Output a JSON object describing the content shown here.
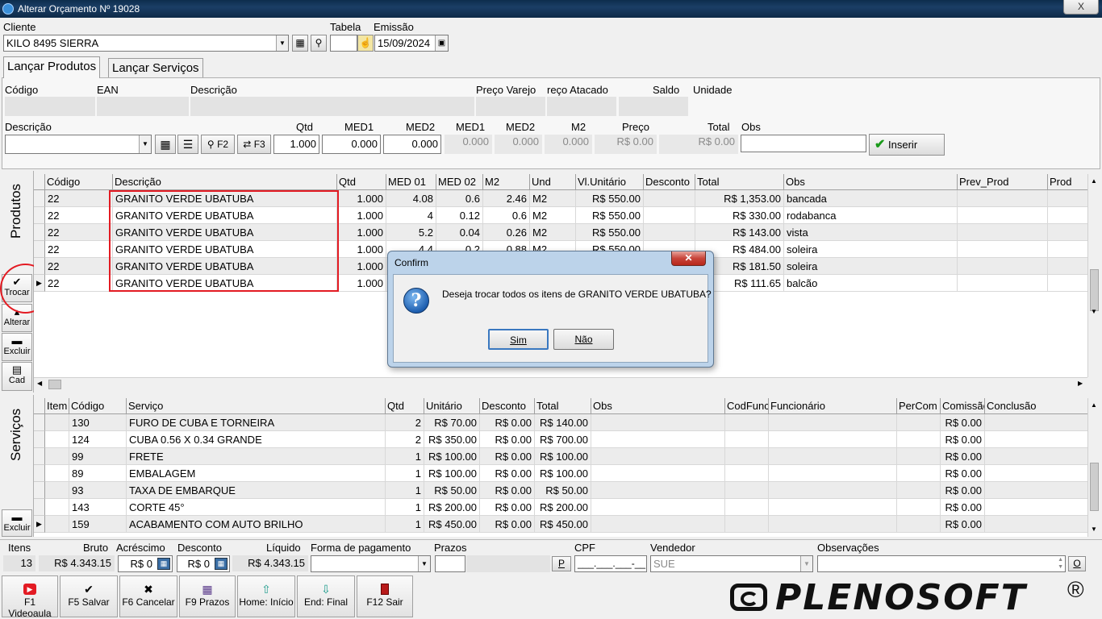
{
  "window": {
    "title": "Alterar Orçamento Nº 19028",
    "close_label": "X"
  },
  "header": {
    "cliente_label": "Cliente",
    "cliente_value": "KILO 8495 SIERRA",
    "tabela_label": "Tabela",
    "emissao_label": "Emissão",
    "emissao_value": "15/09/2024"
  },
  "tabs": [
    {
      "label": "Lançar Produtos",
      "active": true
    },
    {
      "label": "Lançar Serviços",
      "active": false
    }
  ],
  "produto_info": {
    "labels": {
      "codigo": "Código",
      "ean": "EAN",
      "descricao": "Descrição",
      "preco_varejo": "Preço Varejo",
      "preco_atacado": "reço Atacado",
      "saldo": "Saldo",
      "unidade": "Unidade"
    }
  },
  "insert_row": {
    "labels": {
      "descricao": "Descrição",
      "qtd": "Qtd",
      "med1": "MED1",
      "med2": "MED2",
      "med1_ro": "MED1",
      "med2_ro": "MED2",
      "m2": "M2",
      "preco": "Preço",
      "total": "Total",
      "obs": "Obs"
    },
    "values": {
      "qtd": "1.000",
      "med1": "0.000",
      "med2": "0.000",
      "med1_ro": "0.000",
      "med2_ro": "0.000",
      "m2": "0.000",
      "preco": "R$ 0.00",
      "total": "R$ 0.00"
    },
    "f2_label": "F2",
    "f3_label": "F3",
    "inserir_label": "Inserir"
  },
  "side_buttons": {
    "produtos_label": "Produtos",
    "servicos_label": "Serviços",
    "trocar": "Trocar",
    "alterar": "Alterar",
    "excluir": "Excluir",
    "cad": "Cad",
    "excluir2": "Excluir"
  },
  "products_grid": {
    "headers": [
      "Código",
      "Descrição",
      "Qtd",
      "MED 01",
      "MED 02",
      "M2",
      "Und",
      "Vl.Unitário",
      "Desconto",
      "Total",
      "Obs",
      "Prev_Prod",
      "Prod"
    ],
    "rows": [
      [
        "22",
        "GRANITO VERDE UBATUBA",
        "1.000",
        "4.08",
        "0.6",
        "2.46",
        "M2",
        "R$ 550.00",
        "",
        "R$ 1,353.00",
        "bancada",
        "",
        ""
      ],
      [
        "22",
        "GRANITO VERDE UBATUBA",
        "1.000",
        "4",
        "0.12",
        "0.6",
        "M2",
        "R$ 550.00",
        "",
        "R$ 330.00",
        "rodabanca",
        "",
        ""
      ],
      [
        "22",
        "GRANITO VERDE UBATUBA",
        "1.000",
        "5.2",
        "0.04",
        "0.26",
        "M2",
        "R$ 550.00",
        "",
        "R$ 143.00",
        "vista",
        "",
        ""
      ],
      [
        "22",
        "GRANITO VERDE UBATUBA",
        "1.000",
        "4.4",
        "0.2",
        "0.88",
        "M2",
        "R$ 550.00",
        "",
        "R$ 484.00",
        "soleira",
        "",
        ""
      ],
      [
        "22",
        "GRANITO VERDE UBATUBA",
        "1.000",
        "",
        "",
        "",
        "",
        "",
        "",
        "R$ 181.50",
        "soleira",
        "",
        ""
      ],
      [
        "22",
        "GRANITO VERDE UBATUBA",
        "1.000",
        "",
        "",
        "",
        "",
        "",
        "",
        "R$ 111.65",
        "balcão",
        "",
        ""
      ]
    ]
  },
  "services_grid": {
    "headers": [
      "Item",
      "Código",
      "Serviço",
      "Qtd",
      "Unitário",
      "Desconto",
      "Total",
      "Obs",
      "CodFunc",
      "Funcionário",
      "PerCom",
      "Comissão",
      "Conclusão"
    ],
    "rows": [
      [
        "",
        "130",
        "FURO DE CUBA E TORNEIRA",
        "2",
        "R$ 70.00",
        "R$ 0.00",
        "R$ 140.00",
        "",
        "",
        "",
        "",
        "R$ 0.00",
        ""
      ],
      [
        "",
        "124",
        "CUBA 0.56 X 0.34 GRANDE",
        "2",
        "R$ 350.00",
        "R$ 0.00",
        "R$ 700.00",
        "",
        "",
        "",
        "",
        "R$ 0.00",
        ""
      ],
      [
        "",
        "99",
        "FRETE",
        "1",
        "R$ 100.00",
        "R$ 0.00",
        "R$ 100.00",
        "",
        "",
        "",
        "",
        "R$ 0.00",
        ""
      ],
      [
        "",
        "89",
        "EMBALAGEM",
        "1",
        "R$ 100.00",
        "R$ 0.00",
        "R$ 100.00",
        "",
        "",
        "",
        "",
        "R$ 0.00",
        ""
      ],
      [
        "",
        "93",
        "TAXA DE EMBARQUE",
        "1",
        "R$ 50.00",
        "R$ 0.00",
        "R$ 50.00",
        "",
        "",
        "",
        "",
        "R$ 0.00",
        ""
      ],
      [
        "",
        "143",
        "CORTE 45°",
        "1",
        "R$ 200.00",
        "R$ 0.00",
        "R$ 200.00",
        "",
        "",
        "",
        "",
        "R$ 0.00",
        ""
      ],
      [
        "",
        "159",
        "ACABAMENTO COM AUTO BRILHO",
        "1",
        "R$ 450.00",
        "R$ 0.00",
        "R$ 450.00",
        "",
        "",
        "",
        "",
        "R$ 0.00",
        ""
      ]
    ]
  },
  "totals": {
    "labels": {
      "itens": "Itens",
      "bruto": "Bruto",
      "acrescimo": "Acréscimo",
      "desconto": "Desconto",
      "liquido": "Líquido",
      "forma_pagamento": "Forma de pagamento",
      "prazos": "Prazos",
      "cpf": "CPF",
      "vendedor": "Vendedor",
      "observacoes": "Observações"
    },
    "values": {
      "itens": "13",
      "bruto": "R$ 4.343.15",
      "acrescimo": "R$ 0",
      "desconto": "R$ 0",
      "liquido": "R$ 4.343.15",
      "cpf": "___.___.___-__",
      "vendedor": "SUE"
    },
    "prazos_btn": "P",
    "obs_btn": "O"
  },
  "toolbar": [
    {
      "label": "F1 Videoaula",
      "icon": "youtube-icon"
    },
    {
      "label": "F5 Salvar",
      "icon": "check-icon"
    },
    {
      "label": "F6 Cancelar",
      "icon": "x-icon"
    },
    {
      "label": "F9 Prazos",
      "icon": "calendar-icon"
    },
    {
      "label": "Home: Início",
      "icon": "arrow-up-icon"
    },
    {
      "label": "End: Final",
      "icon": "arrow-down-icon"
    },
    {
      "label": "F12 Sair",
      "icon": "exit-door-icon"
    }
  ],
  "logo": {
    "text": "PLENOSOFT",
    "mark": "®"
  },
  "dialog": {
    "title": "Confirm",
    "message": "Deseja trocar todos os itens de GRANITO VERDE UBATUBA?",
    "yes": "Sim",
    "no": "Não"
  },
  "colors": {
    "highlight": "#e31b23",
    "titlebar": "#1b3e66",
    "dialog_frame": "#bcd3ea"
  }
}
